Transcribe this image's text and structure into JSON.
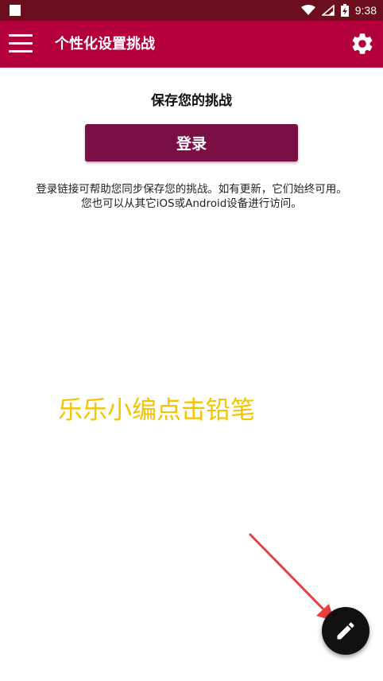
{
  "status_bar": {
    "time": "9:38",
    "icons": [
      "notification-square-icon",
      "wifi-icon",
      "signal-icon",
      "battery-charging-icon"
    ]
  },
  "app_bar": {
    "title": "个性化设置挑战",
    "menu_icon": "menu-icon",
    "settings_icon": "gear-icon",
    "color": "#b4003a"
  },
  "main": {
    "save_title": "保存您的挑战",
    "login_button_label": "登录",
    "description": "登录链接可帮助您同步保存您的挑战。如有更新，它们始终可用。您也可以从其它iOS或Android设备进行访问。",
    "button_color": "#7a0f45"
  },
  "annotation": {
    "text": "乐乐小编点击铅笔",
    "color": "#f5c400",
    "arrow_color": "#e8403e"
  },
  "fab": {
    "icon": "pencil-icon"
  }
}
